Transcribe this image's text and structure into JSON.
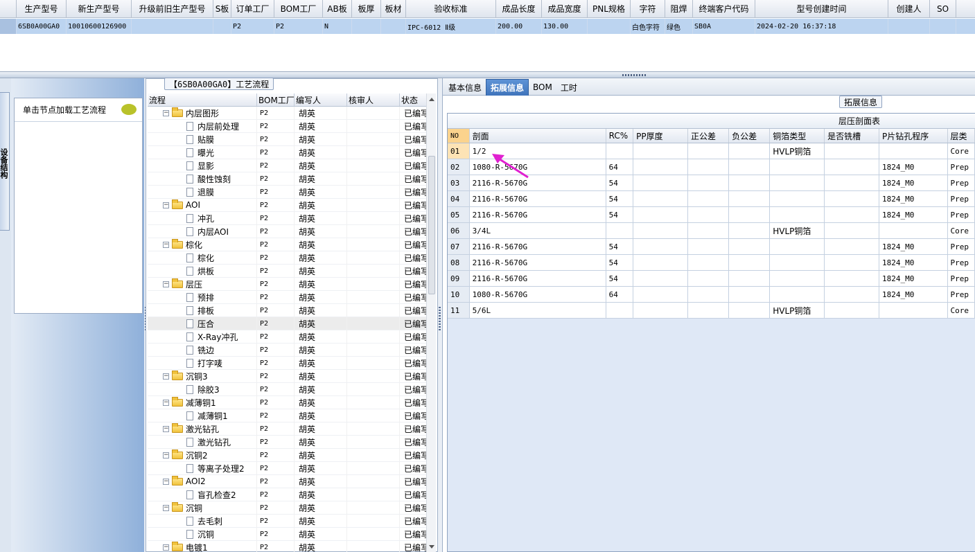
{
  "top_grid": {
    "columns": [
      "生产型号",
      "新生产型号",
      "升级前旧生产型号",
      "S板",
      "订单工厂",
      "BOM工厂",
      "AB板",
      "板厚",
      "板材",
      "验收标准",
      "成品长度",
      "成品宽度",
      "PNL规格",
      "字符",
      "阻焊",
      "终端客户代码",
      "型号创建时间",
      "创建人",
      "SO"
    ],
    "row": {
      "生产型号": "6SB0A00GA0",
      "新生产型号": "10010600126900",
      "升级前旧生产型号": "",
      "S板": "",
      "订单工厂": "P2",
      "BOM工厂": "P2",
      "AB板": "N",
      "板厚": "",
      "板材": "",
      "验收标准": "IPC-6012 Ⅱ级",
      "成品长度": "200.00",
      "成品宽度": "130.00",
      "PNL规格": "",
      "字符": "白色字符",
      "阻焊": "绿色",
      "终端客户代码": "SB0A",
      "型号创建时间": "2024-02-20 16:37:18",
      "创建人": "",
      "SO": ""
    }
  },
  "left_dock": {
    "tab_label": "设备结构",
    "hint_text": "单击节点加载工艺流程"
  },
  "tree": {
    "title": "【6SB0A00GA0】工艺流程",
    "headers": [
      "流程",
      "BOM工厂",
      "编写人",
      "核审人",
      "状态"
    ],
    "rows": [
      {
        "name": "内层图形",
        "level": 0,
        "bom": "P2",
        "writer": "胡英",
        "reviewer": "",
        "status": "已编写"
      },
      {
        "name": "内层前处理",
        "level": 1,
        "bom": "P2",
        "writer": "胡英",
        "reviewer": "",
        "status": "已编写"
      },
      {
        "name": "贴膜",
        "level": 1,
        "bom": "P2",
        "writer": "胡英",
        "reviewer": "",
        "status": "已编写"
      },
      {
        "name": "曝光",
        "level": 1,
        "bom": "P2",
        "writer": "胡英",
        "reviewer": "",
        "status": "已编写"
      },
      {
        "name": "显影",
        "level": 1,
        "bom": "P2",
        "writer": "胡英",
        "reviewer": "",
        "status": "已编写"
      },
      {
        "name": "酸性蚀刻",
        "level": 1,
        "bom": "P2",
        "writer": "胡英",
        "reviewer": "",
        "status": "已编写"
      },
      {
        "name": "退膜",
        "level": 1,
        "bom": "P2",
        "writer": "胡英",
        "reviewer": "",
        "status": "已编写"
      },
      {
        "name": "AOI",
        "level": 0,
        "bom": "P2",
        "writer": "胡英",
        "reviewer": "",
        "status": "已编写"
      },
      {
        "name": "冲孔",
        "level": 1,
        "bom": "P2",
        "writer": "胡英",
        "reviewer": "",
        "status": "已编写"
      },
      {
        "name": "内层AOI",
        "level": 1,
        "bom": "P2",
        "writer": "胡英",
        "reviewer": "",
        "status": "已编写"
      },
      {
        "name": "棕化",
        "level": 0,
        "bom": "P2",
        "writer": "胡英",
        "reviewer": "",
        "status": "已编写"
      },
      {
        "name": "棕化",
        "level": 1,
        "bom": "P2",
        "writer": "胡英",
        "reviewer": "",
        "status": "已编写"
      },
      {
        "name": "烘板",
        "level": 1,
        "bom": "P2",
        "writer": "胡英",
        "reviewer": "",
        "status": "已编写"
      },
      {
        "name": "层压",
        "level": 0,
        "bom": "P2",
        "writer": "胡英",
        "reviewer": "",
        "status": "已编写"
      },
      {
        "name": "预排",
        "level": 1,
        "bom": "P2",
        "writer": "胡英",
        "reviewer": "",
        "status": "已编写"
      },
      {
        "name": "排板",
        "level": 1,
        "bom": "P2",
        "writer": "胡英",
        "reviewer": "",
        "status": "已编写"
      },
      {
        "name": "压合",
        "level": 1,
        "bom": "P2",
        "writer": "胡英",
        "reviewer": "",
        "status": "已编写",
        "selected": true
      },
      {
        "name": "X-Ray冲孔",
        "level": 1,
        "bom": "P2",
        "writer": "胡英",
        "reviewer": "",
        "status": "已编写"
      },
      {
        "name": "铣边",
        "level": 1,
        "bom": "P2",
        "writer": "胡英",
        "reviewer": "",
        "status": "已编写"
      },
      {
        "name": "打字唛",
        "level": 1,
        "bom": "P2",
        "writer": "胡英",
        "reviewer": "",
        "status": "已编写"
      },
      {
        "name": "沉铜3",
        "level": 0,
        "bom": "P2",
        "writer": "胡英",
        "reviewer": "",
        "status": "已编写"
      },
      {
        "name": "除胶3",
        "level": 1,
        "bom": "P2",
        "writer": "胡英",
        "reviewer": "",
        "status": "已编写"
      },
      {
        "name": "减薄铜1",
        "level": 0,
        "bom": "P2",
        "writer": "胡英",
        "reviewer": "",
        "status": "已编写"
      },
      {
        "name": "减薄铜1",
        "level": 1,
        "bom": "P2",
        "writer": "胡英",
        "reviewer": "",
        "status": "已编写"
      },
      {
        "name": "激光钻孔",
        "level": 0,
        "bom": "P2",
        "writer": "胡英",
        "reviewer": "",
        "status": "已编写"
      },
      {
        "name": "激光钻孔",
        "level": 1,
        "bom": "P2",
        "writer": "胡英",
        "reviewer": "",
        "status": "已编写"
      },
      {
        "name": "沉铜2",
        "level": 0,
        "bom": "P2",
        "writer": "胡英",
        "reviewer": "",
        "status": "已编写"
      },
      {
        "name": "等离子处理2",
        "level": 1,
        "bom": "P2",
        "writer": "胡英",
        "reviewer": "",
        "status": "已编写"
      },
      {
        "name": "AOI2",
        "level": 0,
        "bom": "P2",
        "writer": "胡英",
        "reviewer": "",
        "status": "已编写"
      },
      {
        "name": "盲孔检查2",
        "level": 1,
        "bom": "P2",
        "writer": "胡英",
        "reviewer": "",
        "status": "已编写"
      },
      {
        "name": "沉铜",
        "level": 0,
        "bom": "P2",
        "writer": "胡英",
        "reviewer": "",
        "status": "已编写"
      },
      {
        "name": "去毛刺",
        "level": 1,
        "bom": "P2",
        "writer": "胡英",
        "reviewer": "",
        "status": "已编写"
      },
      {
        "name": "沉铜",
        "level": 1,
        "bom": "P2",
        "writer": "胡英",
        "reviewer": "",
        "status": "已编写"
      },
      {
        "name": "电镀1",
        "level": 0,
        "bom": "P2",
        "writer": "胡英",
        "reviewer": "",
        "status": "已编写"
      }
    ]
  },
  "right": {
    "tabs": [
      "基本信息",
      "拓展信息",
      "BOM",
      "工时"
    ],
    "active_tab": "拓展信息",
    "section_title": "拓展信息",
    "table_caption": "层压剖面表",
    "headers": [
      "NO",
      "剖面",
      "RC%",
      "PP厚度",
      "正公差",
      "负公差",
      "铜箔类型",
      "是否铣槽",
      "P片钻孔程序",
      "层类"
    ],
    "rows": [
      {
        "no": "01",
        "section": "1/2",
        "rc": "",
        "pp": "",
        "plus": "",
        "minus": "",
        "foil": "HVLP铜箔",
        "slot": "",
        "program": "",
        "layer": "Core"
      },
      {
        "no": "02",
        "section": "1080-R-5670G",
        "rc": "64",
        "pp": "",
        "plus": "",
        "minus": "",
        "foil": "",
        "slot": "",
        "program": "1824_M0",
        "layer": "Prep"
      },
      {
        "no": "03",
        "section": "2116-R-5670G",
        "rc": "54",
        "pp": "",
        "plus": "",
        "minus": "",
        "foil": "",
        "slot": "",
        "program": "1824_M0",
        "layer": "Prep"
      },
      {
        "no": "04",
        "section": "2116-R-5670G",
        "rc": "54",
        "pp": "",
        "plus": "",
        "minus": "",
        "foil": "",
        "slot": "",
        "program": "1824_M0",
        "layer": "Prep"
      },
      {
        "no": "05",
        "section": "2116-R-5670G",
        "rc": "54",
        "pp": "",
        "plus": "",
        "minus": "",
        "foil": "",
        "slot": "",
        "program": "1824_M0",
        "layer": "Prep"
      },
      {
        "no": "06",
        "section": "3/4L",
        "rc": "",
        "pp": "",
        "plus": "",
        "minus": "",
        "foil": "HVLP铜箔",
        "slot": "",
        "program": "",
        "layer": "Core"
      },
      {
        "no": "07",
        "section": "2116-R-5670G",
        "rc": "54",
        "pp": "",
        "plus": "",
        "minus": "",
        "foil": "",
        "slot": "",
        "program": "1824_M0",
        "layer": "Prep"
      },
      {
        "no": "08",
        "section": "2116-R-5670G",
        "rc": "54",
        "pp": "",
        "plus": "",
        "minus": "",
        "foil": "",
        "slot": "",
        "program": "1824_M0",
        "layer": "Prep"
      },
      {
        "no": "09",
        "section": "2116-R-5670G",
        "rc": "54",
        "pp": "",
        "plus": "",
        "minus": "",
        "foil": "",
        "slot": "",
        "program": "1824_M0",
        "layer": "Prep"
      },
      {
        "no": "10",
        "section": "1080-R-5670G",
        "rc": "64",
        "pp": "",
        "plus": "",
        "minus": "",
        "foil": "",
        "slot": "",
        "program": "1824_M0",
        "layer": "Prep"
      },
      {
        "no": "11",
        "section": "5/6L",
        "rc": "",
        "pp": "",
        "plus": "",
        "minus": "",
        "foil": "HVLP铜箔",
        "slot": "",
        "program": "",
        "layer": "Core"
      }
    ]
  },
  "colors": {
    "selected_row": "#bcd4f0",
    "active_tab": "#4a80c8",
    "arrow": "#e020d0"
  }
}
